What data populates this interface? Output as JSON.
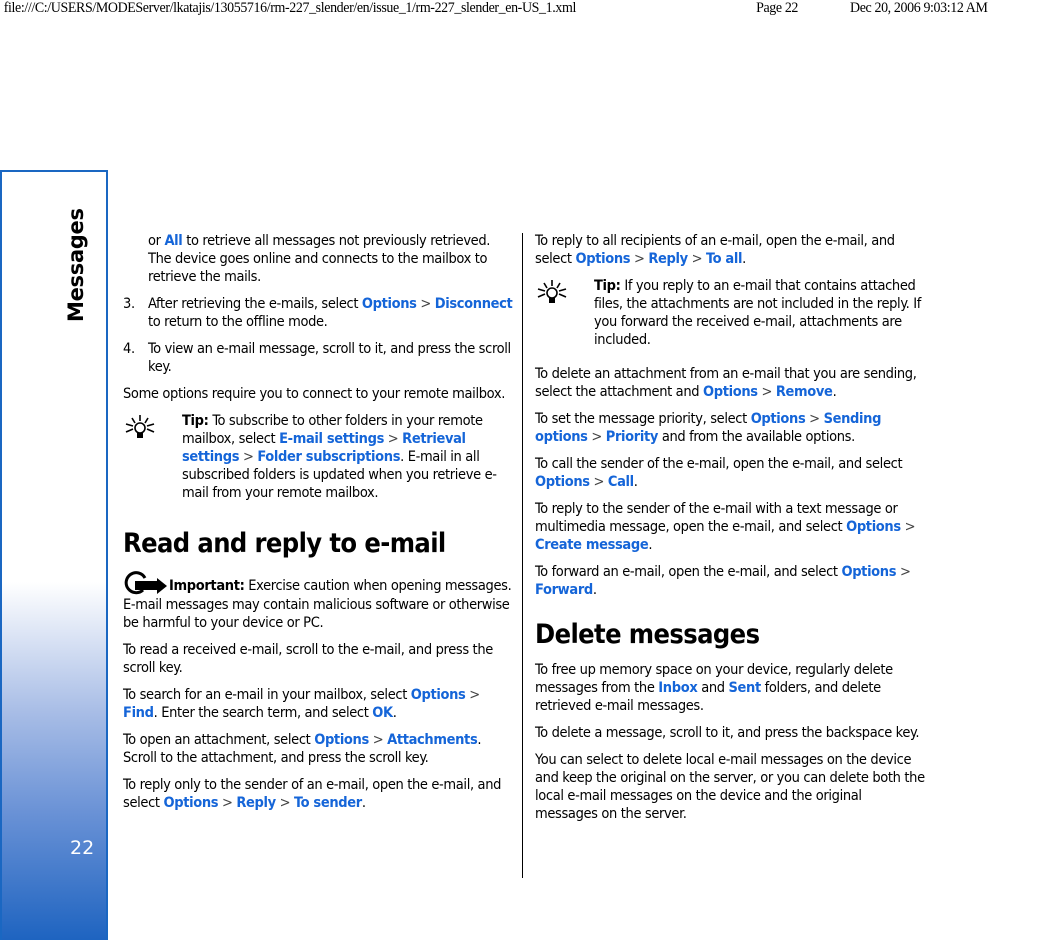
{
  "print_header": {
    "url": "file:///C:/USERS/MODEServer/lkatajis/13055716/rm-227_slender/en/issue_1/rm-227_slender_en-US_1.xml",
    "page": "Page 22",
    "datetime": "Dec 20, 2006 9:03:12 AM"
  },
  "sidebar": {
    "section_title": "Messages",
    "page_number": "22",
    "accent_color": "#1a67c2"
  },
  "left": {
    "cont": {
      "t1": "or ",
      "l1": "All",
      "t2": " to retrieve all messages not previously retrieved. The device goes online and connects to the mailbox to retrieve the mails."
    },
    "step3": {
      "num": "3.",
      "t1": "After retrieving the e-mails, select ",
      "l1": "Options",
      "sep": " > ",
      "l2": "Disconnect",
      "t2": " to return to the offline mode."
    },
    "step4": {
      "num": "4.",
      "text": "To view an e-mail message, scroll to it, and press the scroll key."
    },
    "remote": "Some options require you to connect to your remote mailbox.",
    "tip": {
      "label": "Tip:",
      "t1": " To subscribe to other folders in your remote mailbox, select ",
      "l1": "E-mail settings",
      "sep1": " > ",
      "l2": "Retrieval settings",
      "sep2": " > ",
      "l3": "Folder subscriptions",
      "t2": ". E-mail in all subscribed folders is updated when you retrieve e-mail from your remote mailbox."
    },
    "heading": "Read and reply to e-mail",
    "important": {
      "label": "Important:",
      "text": "  Exercise caution when opening messages. E-mail messages may contain malicious software or otherwise be harmful to your device or PC."
    },
    "read": "To read a received e-mail, scroll to the e-mail, and press the scroll key.",
    "search": {
      "t1": "To search for an e-mail in your mailbox, select ",
      "l1": "Options",
      "sep": " > ",
      "l2": "Find",
      "t2": ". Enter the search term, and select ",
      "l3": "OK",
      "t3": "."
    },
    "attach": {
      "t1": "To open an attachment, select ",
      "l1": "Options",
      "sep": " > ",
      "l2": "Attachments",
      "t2": ". Scroll to the attachment, and press the scroll key."
    },
    "reply_sender": {
      "t1": "To reply only to the sender of an e-mail, open the e-mail, and select ",
      "l1": "Options",
      "sep1": " > ",
      "l2": "Reply",
      "sep2": " > ",
      "l3": "To sender",
      "t2": "."
    }
  },
  "right": {
    "reply_all": {
      "t1": "To reply to all recipients of an e-mail, open the e-mail, and select ",
      "l1": "Options",
      "sep1": " > ",
      "l2": "Reply",
      "sep2": " > ",
      "l3": "To all",
      "t2": "."
    },
    "tip": {
      "label": "Tip:",
      "text": " If you reply to an e-mail that contains attached files, the attachments are not included in the reply. If you forward the received e-mail, attachments are included."
    },
    "remove": {
      "t1": "To delete an attachment from an e-mail that you are sending, select the attachment and ",
      "l1": "Options",
      "sep": " > ",
      "l2": "Remove",
      "t2": "."
    },
    "priority": {
      "t1": "To set the message priority, select ",
      "l1": "Options",
      "sep1": " > ",
      "l2": "Sending options",
      "sep2": " > ",
      "l3": "Priority",
      "t2": " and from the available options."
    },
    "call": {
      "t1": "To call the sender of the e-mail, open the e-mail, and select ",
      "l1": "Options",
      "sep": " > ",
      "l2": "Call",
      "t2": "."
    },
    "create": {
      "t1": "To reply to the sender of the e-mail with a text message or multimedia message, open the e-mail, and select ",
      "l1": "Options",
      "sep": " > ",
      "l2": "Create message",
      "t2": "."
    },
    "forward": {
      "t1": "To forward an e-mail, open the e-mail, and select ",
      "l1": "Options",
      "sep": " > ",
      "l2": "Forward",
      "t2": "."
    },
    "heading": "Delete messages",
    "free": {
      "t1": "To free up memory space on your device, regularly delete messages from the ",
      "l1": "Inbox",
      "t2": " and ",
      "l2": "Sent",
      "t3": " folders, and delete retrieved e-mail messages."
    },
    "delete": "To delete a message, scroll to it, and press the backspace key.",
    "local": "You can select to delete local e-mail messages on the device and keep the original on the server, or you can delete both the local e-mail messages on the device and the original messages on the server."
  },
  "colors": {
    "link": "#1565d8",
    "text": "#000000"
  }
}
